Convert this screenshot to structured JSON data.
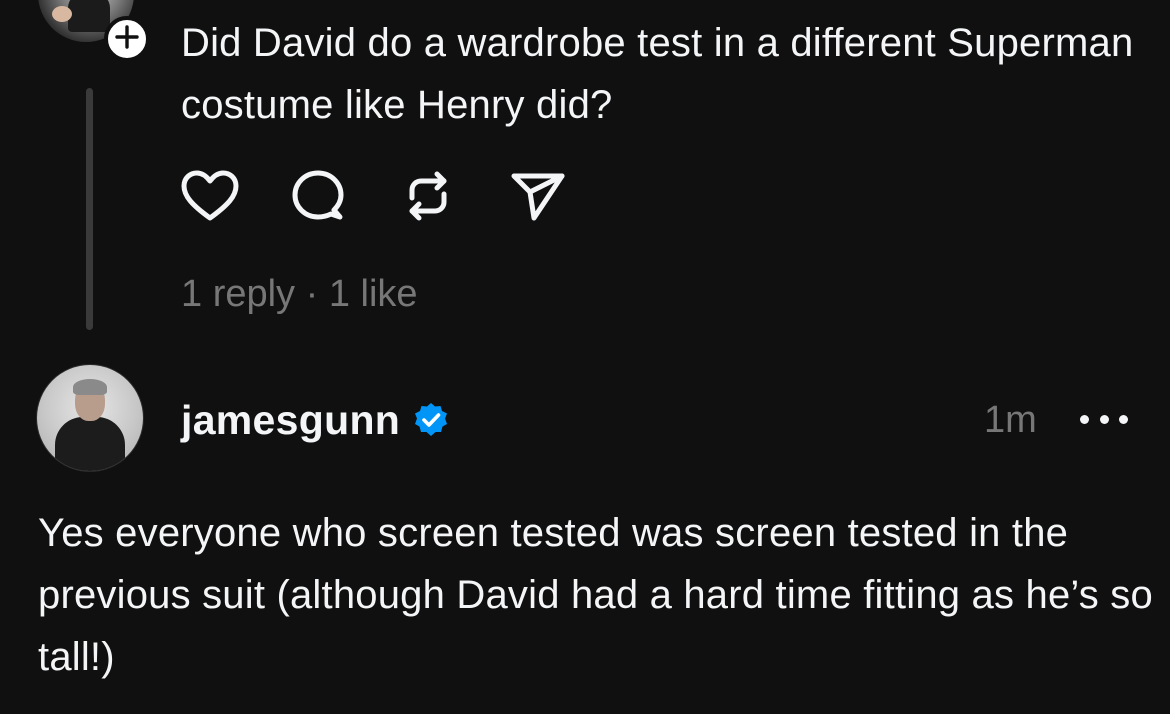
{
  "parent_post": {
    "text": "Did David do a wardrobe test in a different Superman costume like Henry did?",
    "avatar_icon": "user-avatar",
    "follow_icon": "plus-icon",
    "actions": [
      {
        "name": "like",
        "icon": "heart-icon"
      },
      {
        "name": "reply",
        "icon": "comment-icon"
      },
      {
        "name": "repost",
        "icon": "repost-icon"
      },
      {
        "name": "share",
        "icon": "send-icon"
      }
    ],
    "stats": {
      "replies": "1 reply",
      "separator": " · ",
      "likes": "1 like"
    }
  },
  "reply_post": {
    "username": "jamesgunn",
    "verified_icon": "verified-badge-icon",
    "verified_color": "#0095f6",
    "timestamp": "1m",
    "more_icon": "more-icon",
    "text": "Yes everyone who screen tested was screen tested in the previous suit (although David had a hard time fitting as he’s so tall!)"
  },
  "colors": {
    "background": "#101010",
    "text": "#f3f5f7",
    "muted": "#777777",
    "thread_line": "#3a3a3a"
  }
}
